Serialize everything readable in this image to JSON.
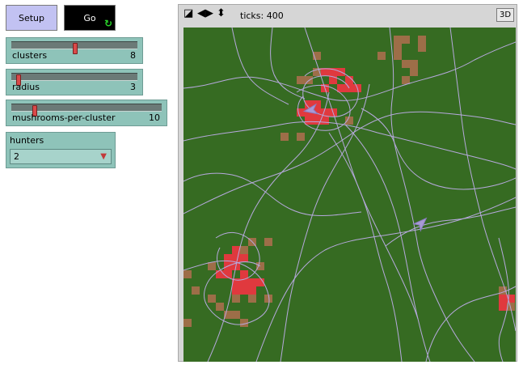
{
  "buttons": {
    "setup": "Setup",
    "go": "Go",
    "go_forever_icon": "forever-arrows-icon"
  },
  "sliders": [
    {
      "id": "clusters",
      "label": "clusters",
      "value": "8",
      "fraction": 0.5
    },
    {
      "id": "radius",
      "label": "radius",
      "value": "3",
      "fraction": 0.05
    },
    {
      "id": "mush",
      "label": "mushrooms-per-cluster",
      "value": "10",
      "fraction": 0.15
    }
  ],
  "chooser": {
    "label": "hunters",
    "value": "2"
  },
  "view": {
    "ticks": "ticks: 400",
    "three_d": "3D",
    "icons": [
      "edit-icon",
      "left-right-arrows-icon",
      "up-down-arrows-icon"
    ]
  },
  "colors": {
    "background": "#366b22",
    "mushroom": "#e0393e",
    "soil": "#9d6e48",
    "trail": "#b6a9dd",
    "hunter": "#a89ad6"
  }
}
